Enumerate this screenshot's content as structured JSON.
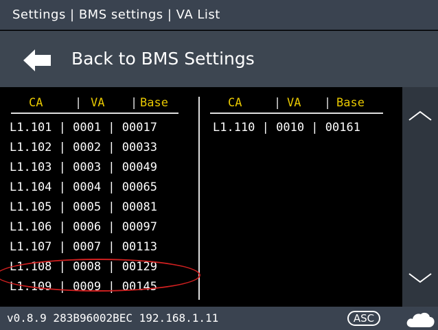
{
  "header": {
    "breadcrumb": "Settings | BMS settings | VA List"
  },
  "back": {
    "label": "Back to BMS Settings",
    "icon": "arrow-left-icon"
  },
  "table": {
    "left": {
      "headers": [
        "CA",
        "VA",
        "Base"
      ],
      "rows": [
        "L1.101 | 0001 | 00017",
        "L1.102 | 0002 | 00033",
        "L1.103 | 0003 | 00049",
        "L1.104 | 0004 | 00065",
        "L1.105 | 0005 | 00081",
        "L1.106 | 0006 | 00097",
        "L1.107 | 0007 | 00113",
        "L1.108 | 0008 | 00129",
        "L1.109 | 0009 | 00145"
      ]
    },
    "right": {
      "headers": [
        "CA",
        "VA",
        "Base"
      ],
      "rows": [
        "L1.110 | 0010 | 00161"
      ]
    },
    "highlighted_row": "L1.104 | 0004 | 00065"
  },
  "scroll": {
    "up_icon": "chevron-up-icon",
    "down_icon": "chevron-down-icon"
  },
  "status": {
    "info": "v0.8.9 283B96002BEC 192.168.1.11",
    "sort_badge": "ASC",
    "cloud_icon": "cloud-icon"
  },
  "colors": {
    "header_bg": "#3a4350",
    "list_bg": "#000000",
    "column_header": "#e8c800",
    "text": "#ffffff",
    "highlight": "#d02020"
  }
}
